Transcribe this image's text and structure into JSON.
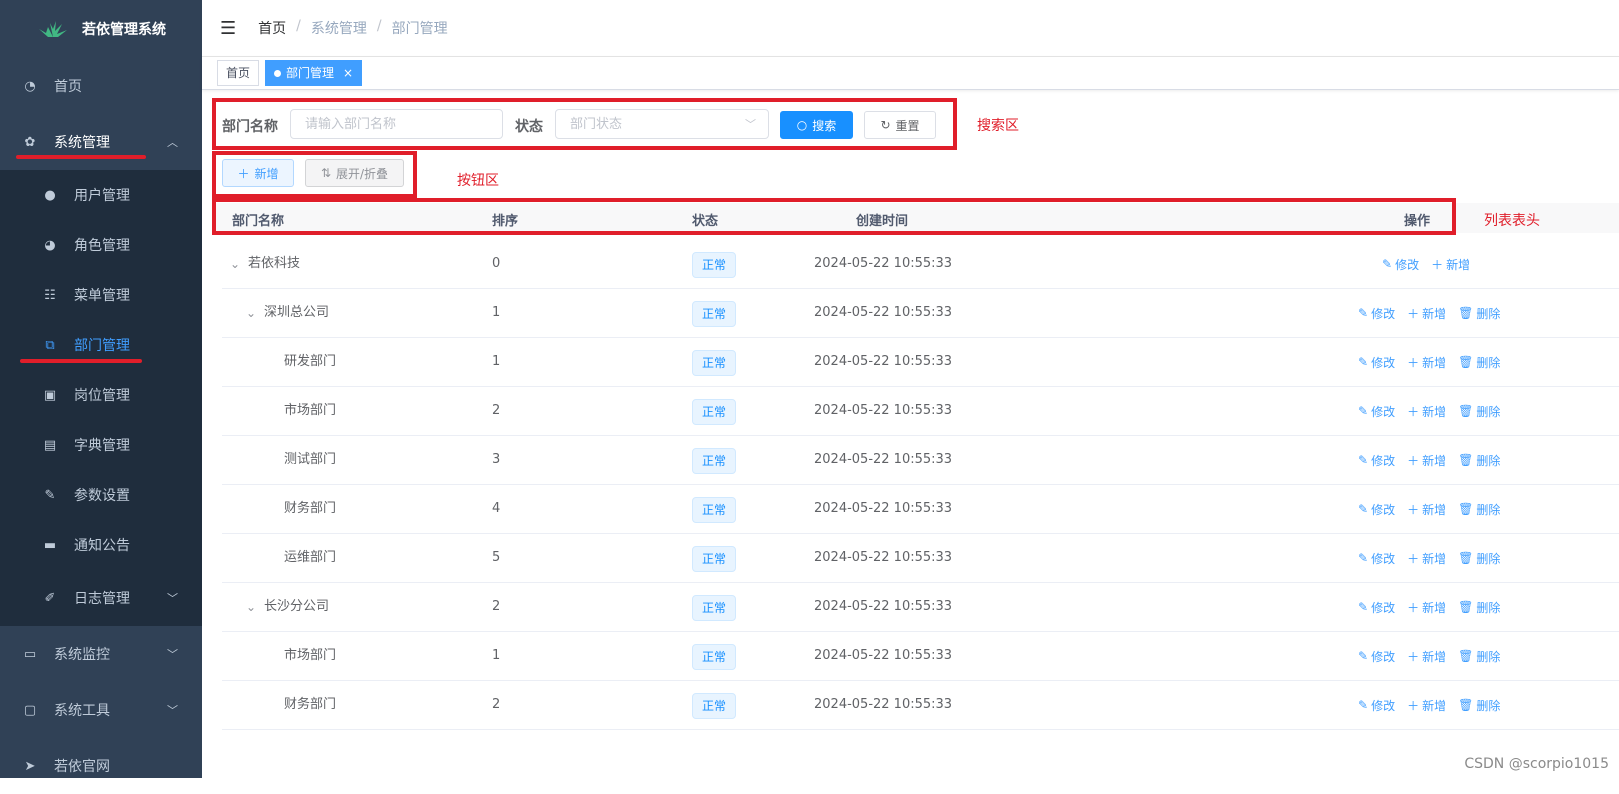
{
  "sidebar": {
    "title": "若依管理系统",
    "items": [
      {
        "label": "首页",
        "icon": "dashboard-icon"
      },
      {
        "label": "系统管理",
        "icon": "gear-icon",
        "expanded": true,
        "children": [
          {
            "label": "用户管理",
            "icon": "user-icon"
          },
          {
            "label": "角色管理",
            "icon": "peoples-icon"
          },
          {
            "label": "菜单管理",
            "icon": "tree-table-icon"
          },
          {
            "label": "部门管理",
            "icon": "tree-icon",
            "active": true
          },
          {
            "label": "岗位管理",
            "icon": "post-icon"
          },
          {
            "label": "字典管理",
            "icon": "dict-icon"
          },
          {
            "label": "参数设置",
            "icon": "edit-icon"
          },
          {
            "label": "通知公告",
            "icon": "message-icon"
          },
          {
            "label": "日志管理",
            "icon": "log-icon"
          }
        ]
      },
      {
        "label": "系统监控",
        "icon": "monitor-icon"
      },
      {
        "label": "系统工具",
        "icon": "tool-icon"
      },
      {
        "label": "若依官网",
        "icon": "guide-icon"
      }
    ]
  },
  "breadcrumb": [
    "首页",
    "/",
    "系统管理",
    "/",
    "部门管理"
  ],
  "tags": [
    {
      "label": "首页"
    },
    {
      "label": "部门管理",
      "close": "×"
    }
  ],
  "search": {
    "name_label": "部门名称",
    "name_placeholder": "请输入部门名称",
    "status_label": "状态",
    "status_placeholder": "部门状态",
    "search_button": "搜索",
    "reset_button": "重置"
  },
  "toolbar": {
    "add_button": "新增",
    "toggle_button": "展开/折叠"
  },
  "annotations": {
    "search_area": "搜索区",
    "button_area": "按钮区",
    "table_header": "列表表头"
  },
  "table": {
    "headers": {
      "name": "部门名称",
      "order": "排序",
      "status": "状态",
      "created": "创建时间",
      "ops": "操作"
    },
    "rows": [
      {
        "name": "若依科技",
        "level": 0,
        "expand": "⌄",
        "order": "0",
        "status": "正常",
        "created": "2024-05-22 10:55:33",
        "ops": [
          "修改",
          "新增"
        ]
      },
      {
        "name": "深圳总公司",
        "level": 1,
        "expand": "⌄",
        "order": "1",
        "status": "正常",
        "created": "2024-05-22 10:55:33",
        "ops": [
          "修改",
          "新增",
          "删除"
        ]
      },
      {
        "name": "研发部门",
        "level": 2,
        "expand": "",
        "order": "1",
        "status": "正常",
        "created": "2024-05-22 10:55:33",
        "ops": [
          "修改",
          "新增",
          "删除"
        ]
      },
      {
        "name": "市场部门",
        "level": 2,
        "expand": "",
        "order": "2",
        "status": "正常",
        "created": "2024-05-22 10:55:33",
        "ops": [
          "修改",
          "新增",
          "删除"
        ]
      },
      {
        "name": "测试部门",
        "level": 2,
        "expand": "",
        "order": "3",
        "status": "正常",
        "created": "2024-05-22 10:55:33",
        "ops": [
          "修改",
          "新增",
          "删除"
        ]
      },
      {
        "name": "财务部门",
        "level": 2,
        "expand": "",
        "order": "4",
        "status": "正常",
        "created": "2024-05-22 10:55:33",
        "ops": [
          "修改",
          "新增",
          "删除"
        ]
      },
      {
        "name": "运维部门",
        "level": 2,
        "expand": "",
        "order": "5",
        "status": "正常",
        "created": "2024-05-22 10:55:33",
        "ops": [
          "修改",
          "新增",
          "删除"
        ]
      },
      {
        "name": "长沙分公司",
        "level": 1,
        "expand": "⌄",
        "order": "2",
        "status": "正常",
        "created": "2024-05-22 10:55:33",
        "ops": [
          "修改",
          "新增",
          "删除"
        ]
      },
      {
        "name": "市场部门",
        "level": 2,
        "expand": "",
        "order": "1",
        "status": "正常",
        "created": "2024-05-22 10:55:33",
        "ops": [
          "修改",
          "新增",
          "删除"
        ]
      },
      {
        "name": "财务部门",
        "level": 2,
        "expand": "",
        "order": "2",
        "status": "正常",
        "created": "2024-05-22 10:55:33",
        "ops": [
          "修改",
          "新增",
          "删除"
        ]
      }
    ]
  },
  "watermark": "CSDN @scorpio1015",
  "colors": {
    "sidebar_bg": "#304156",
    "submenu_bg": "#1f2d3d",
    "primary": "#1890ff",
    "annotation_red": "#e01e2a"
  }
}
